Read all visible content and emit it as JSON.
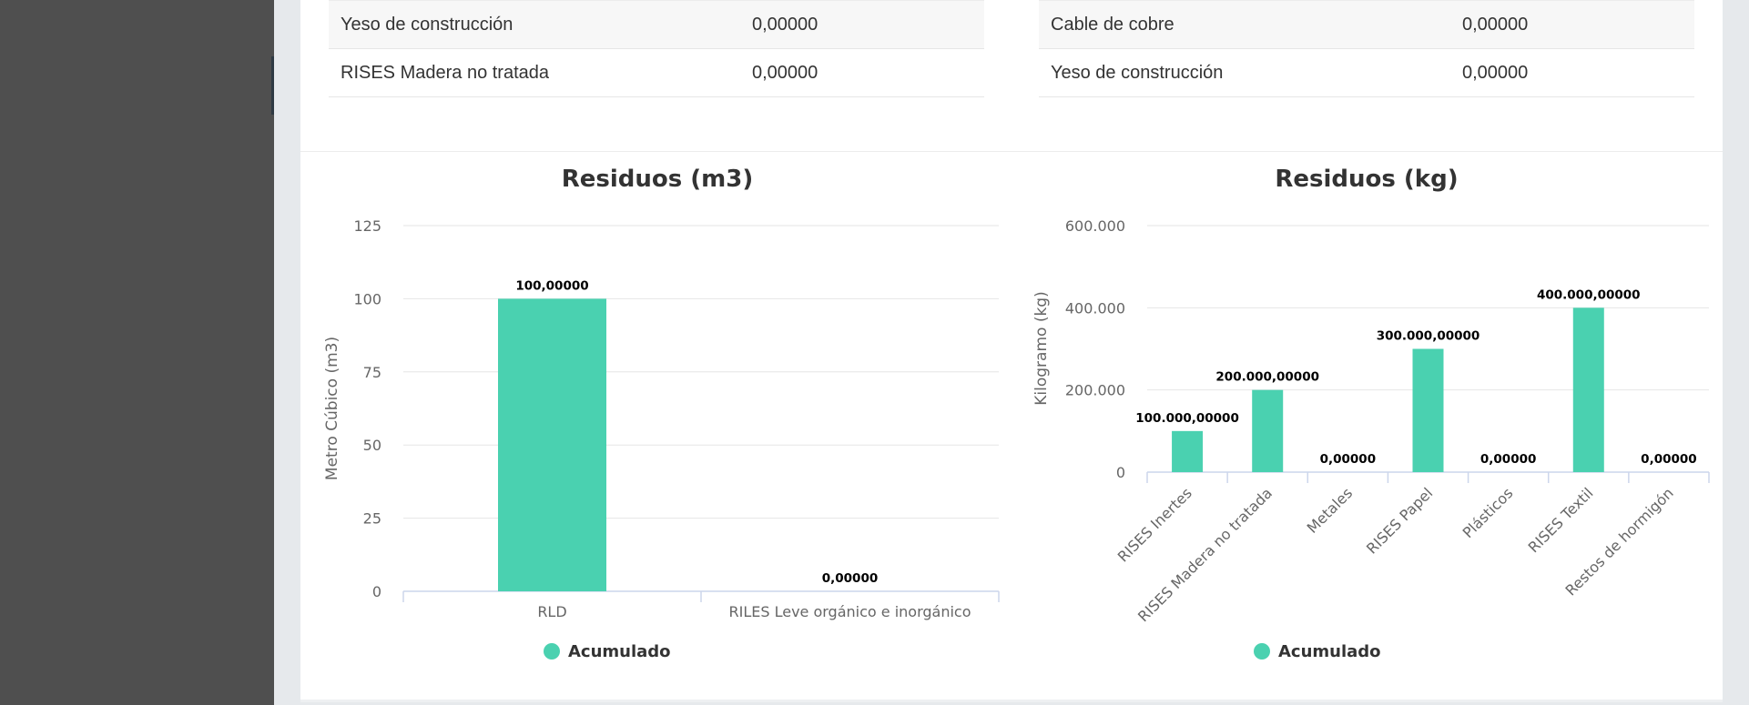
{
  "tables": {
    "left": [
      {
        "name": "Yeso de construcción",
        "value": "0,00000"
      },
      {
        "name": "RISES Madera no tratada",
        "value": "0,00000"
      }
    ],
    "right": [
      {
        "name": "Cable de cobre",
        "value": "0,00000"
      },
      {
        "name": "Yeso de construcción",
        "value": "0,00000"
      }
    ]
  },
  "colors": {
    "bar": "#4ad1b0",
    "sidebar": "#4f4f4f",
    "background": "#e6e9ec"
  },
  "chart_data": [
    {
      "type": "bar",
      "title": "Residuos (m3)",
      "xlabel": "",
      "ylabel": "Metro Cúbico (m3)",
      "categories": [
        "RLD",
        "RILES Leve orgánico e inorgánico"
      ],
      "series": [
        {
          "name": "Acumulado",
          "values": [
            100,
            0
          ]
        }
      ],
      "data_labels": [
        "100,00000",
        "0,00000"
      ],
      "ylim": [
        0,
        125
      ],
      "yticks": [
        0,
        25,
        50,
        75,
        100,
        125
      ],
      "ytick_labels": [
        "0",
        "25",
        "50",
        "75",
        "100",
        "125"
      ],
      "grid": true,
      "legend": "bottom-center"
    },
    {
      "type": "bar",
      "title": "Residuos (kg)",
      "xlabel": "",
      "ylabel": "Kilogramo (kg)",
      "categories": [
        "RISES Inertes",
        "RISES Madera no tratada",
        "Metales",
        "RISES Papel",
        "Plásticos",
        "RISES Textil",
        "Restos de hormigón"
      ],
      "series": [
        {
          "name": "Acumulado",
          "values": [
            100000,
            200000,
            0,
            300000,
            0,
            400000,
            0
          ]
        }
      ],
      "data_labels": [
        "100.000,00000",
        "200.000,00000",
        "0,00000",
        "300.000,00000",
        "0,00000",
        "400.000,00000",
        "0,00000"
      ],
      "ylim": [
        0,
        600000
      ],
      "yticks": [
        0,
        200000,
        400000,
        600000
      ],
      "ytick_labels": [
        "0",
        "200.000",
        "400.000",
        "600.000"
      ],
      "grid": true,
      "legend": "bottom-center"
    }
  ]
}
